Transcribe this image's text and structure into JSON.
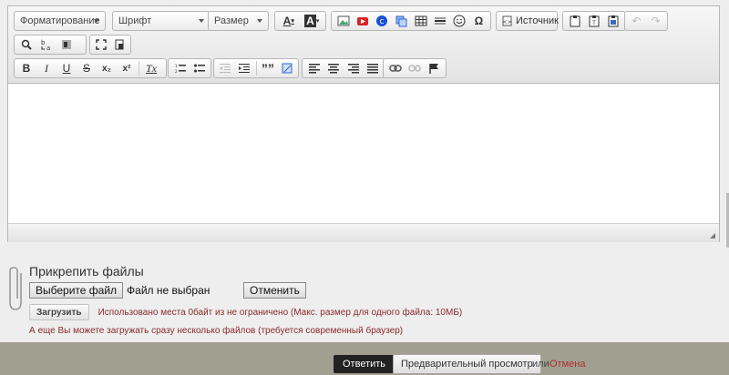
{
  "toolbar": {
    "format_label": "Форматирование",
    "font_label": "Шрифт",
    "size_label": "Размер",
    "source_label": "Источник",
    "text_color_glyph": "A",
    "bg_color_glyph": "A",
    "special_char_glyph": "Ω",
    "blockquote_glyph": "””",
    "bold_glyph": "B",
    "italic_glyph": "I",
    "underline_glyph": "U",
    "strike_glyph": "S",
    "subscript_glyph": "x₂",
    "superscript_glyph": "x²",
    "remove_format_glyph": "Tx"
  },
  "editor": {
    "content": ""
  },
  "attachments": {
    "title": "Прикрепить файлы",
    "choose_file_label": "Выберите файл",
    "no_file_text": "Файл не выбран",
    "cancel_label": "Отменить",
    "upload_label": "Загрузить",
    "usage_note": "Использовано места 0байт из не ограничено (Макс. размер для одного файла: 10МБ)",
    "multi_note": "А еще Вы можете загружать сразу несколько файлов (требуется современный браузер)"
  },
  "footer": {
    "reply_label": "Ответить",
    "preview_label": "Предварительный просмотр",
    "or_text": "или",
    "cancel_link": "Отмена"
  },
  "colors": {
    "footer_bg": "#a19f8f",
    "note_color": "#8b2a2a",
    "cancel_link": "#b03030"
  }
}
